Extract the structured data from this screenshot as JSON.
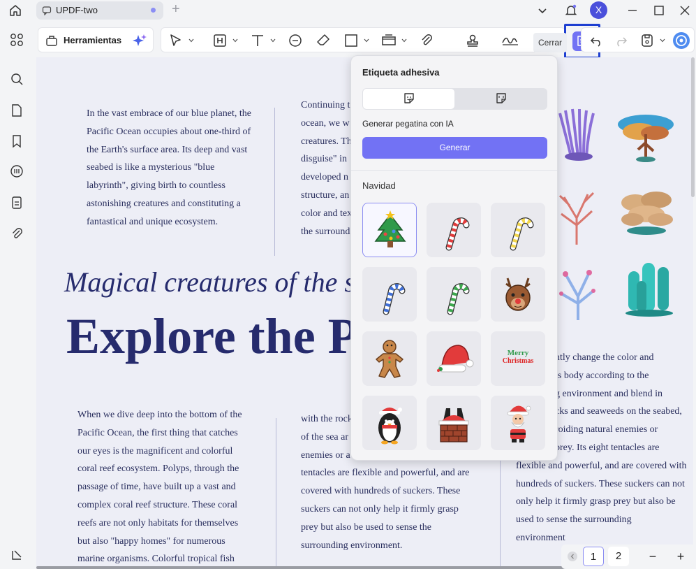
{
  "tab": {
    "title": "UPDF-two"
  },
  "user": {
    "initial": "X"
  },
  "toolbar": {
    "tools_label": "Herramientas",
    "close_label": "Cerrar"
  },
  "panel": {
    "title": "Etiqueta adhesiva",
    "ai_label": "Generar pegatina con IA",
    "generate_label": "Generar",
    "category": "Navidad",
    "stickers": [
      "christmas-tree",
      "candy-cane-red",
      "candy-cane-yellow",
      "candy-cane-blue",
      "candy-cane-green",
      "reindeer",
      "gingerbread-man",
      "santa-hat",
      "merry-christmas",
      "penguin",
      "santa-chimney",
      "santa-claus"
    ],
    "sticker_text": {
      "merry": "Merry",
      "christmas": "Christmas"
    }
  },
  "document": {
    "p1": [
      "In the vast embrace of our blue planet, the",
      "Pacific Ocean occupies about one-third of",
      "the Earth's surface area. Its deep and vast",
      "seabed is like a mysterious \"blue",
      "labyrinth\", giving birth to countless",
      "astonishing creatures and constituting a",
      "fantastical and unique ecosystem."
    ],
    "p2": [
      "Continuing t",
      "ocean, we w",
      "creatures. Th",
      "disguise\" in",
      "developed n",
      "structure, an",
      "color and tex",
      "the surround"
    ],
    "heading_italic": "Magical creatures of the s",
    "heading_big": "Explore the P",
    "p3": [
      "When we dive deep into the bottom of the",
      "Pacific Ocean, the first thing that catches",
      "our eyes is the magnificent and colorful",
      "coral reef ecosystem. Polyps, through the",
      "passage of time, have built up a vast and",
      "complex coral reef structure. These coral",
      "reefs are not only habitats for themselves",
      "but also \"happy homes\" for numerous",
      "marine organisms. Colorful tropical fish"
    ],
    "p4": [
      "with the rock",
      "of the sea ar",
      "enemies or a",
      "tentacles are flexible and powerful, and are",
      "covered with hundreds of suckers. These",
      "suckers can not only help it firmly grasp",
      "prey but also be used to sense the",
      "surrounding environment."
    ],
    "p5": [
      "ntly change the color and",
      "ts body according to the",
      "g environment and blend in",
      "cks and seaweeds on the seabed,",
      "roiding natural enemies or",
      "prey. Its eight tentacles are",
      "flexible and powerful, and are covered with",
      "hundreds of suckers. These suckers can not",
      "only help it firmly grasp prey but also be",
      "used to sense the surrounding",
      "environment"
    ]
  },
  "pager": {
    "page1": "1",
    "page2": "2",
    "minus": "−",
    "plus": "+"
  },
  "colors": {
    "accent": "#7272f4",
    "highlight": "#1e3fd1",
    "doc_text": "#262b6d",
    "coral_teal": "#2fb8b2",
    "coral_red": "#d9776e"
  }
}
